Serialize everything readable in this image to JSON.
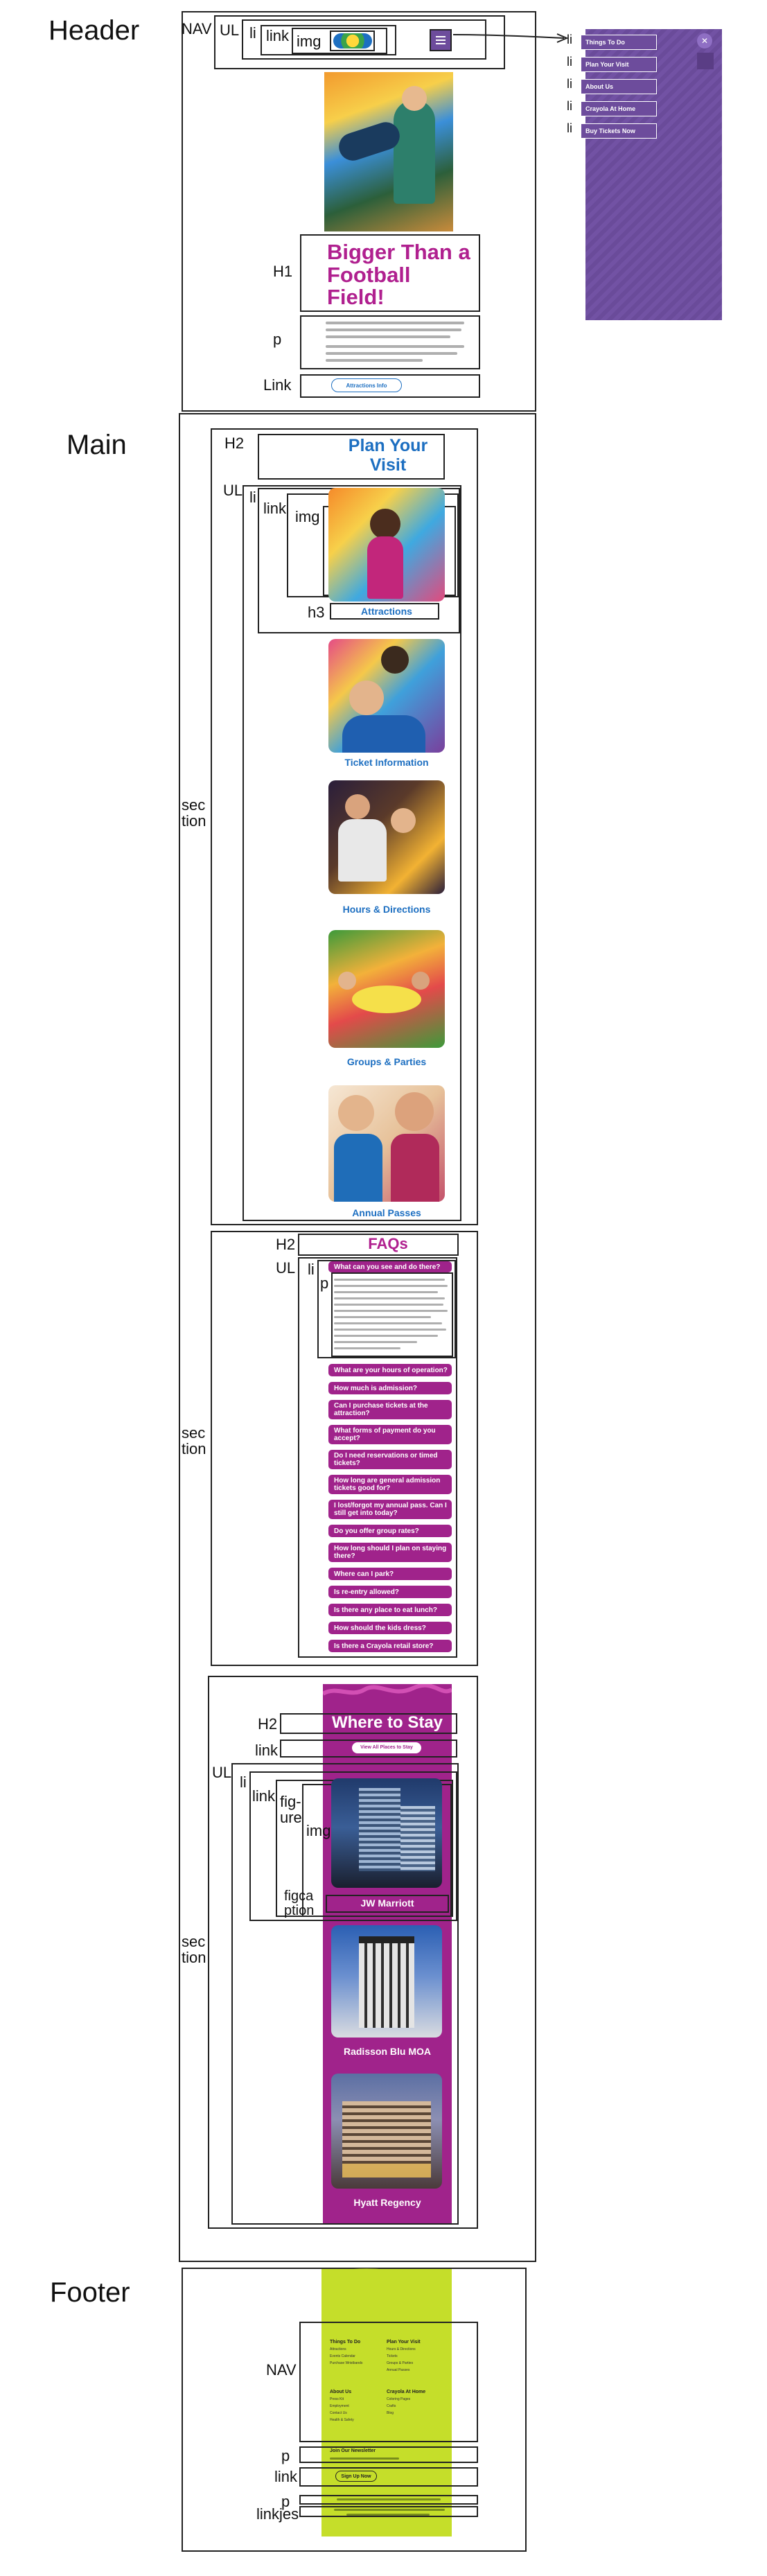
{
  "sections": {
    "header": "Header",
    "main": "Main",
    "footer": "Footer"
  },
  "tags": {
    "nav": "NAV",
    "ul": "UL",
    "li": "li",
    "link": "link",
    "img": "img",
    "h1": "H1",
    "p": "p",
    "link_cap": "Link",
    "h2": "H2",
    "h3": "h3",
    "section": "sec\ntion",
    "figure": "fig-\nure",
    "figcaption": "figca\nption",
    "linkjes": "linkjes"
  },
  "header": {
    "hero_title": "Bigger Than a Football Field!",
    "cta_label": "Attractions Info",
    "menu_items": [
      "Things To Do",
      "Plan Your Visit",
      "About Us",
      "Crayola At Home",
      "Buy Tickets Now"
    ]
  },
  "visit": {
    "title": "Plan Your Visit",
    "cards": [
      "Attractions",
      "Ticket Information",
      "Hours & Directions",
      "Groups & Parties",
      "Annual Passes"
    ]
  },
  "faqs": {
    "title": "FAQs",
    "open_question": "What can you see and do there?",
    "questions": [
      "What are your hours of operation?",
      "How much is admission?",
      "Can I purchase tickets at the attraction?",
      "What forms of payment do you accept?",
      "Do I need reservations or timed tickets?",
      "How long are general admission tickets good for?",
      "I lost/forgot my annual pass. Can I still get into today?",
      "Do you offer group rates?",
      "How long should I plan on staying there?",
      "Where can I park?",
      "Is re-entry allowed?",
      "Is there any place to eat lunch?",
      "How should the kids dress?",
      "Is there a Crayola retail store?"
    ]
  },
  "stay": {
    "title": "Where to Stay",
    "view_all": "View All Places to Stay",
    "hotels": [
      "JW Marriott",
      "Radisson Blu MOA",
      "Hyatt Regency"
    ]
  },
  "footer": {
    "columns": [
      {
        "heading": "Things To Do",
        "links": [
          "Attractions",
          "Events Calendar",
          "Purchase Wristbands"
        ]
      },
      {
        "heading": "Plan Your Visit",
        "links": [
          "Hours & Directions",
          "Tickets",
          "Groups & Parties",
          "Annual Passes"
        ]
      },
      {
        "heading": "About Us",
        "links": [
          "Press Kit",
          "Employment",
          "Contact Us",
          "Health & Safety"
        ]
      },
      {
        "heading": "Crayola At Home",
        "links": [
          "Coloring Pages",
          "Crafts",
          "Blog"
        ]
      }
    ],
    "newsletter": "Join Our Newsletter",
    "signup": "Sign Up Now"
  },
  "colors": {
    "brand_purple": "#6d4c9c",
    "brand_magenta": "#a0238b",
    "brand_blue": "#1d6fc1",
    "footer_lime": "#c5de2a"
  }
}
